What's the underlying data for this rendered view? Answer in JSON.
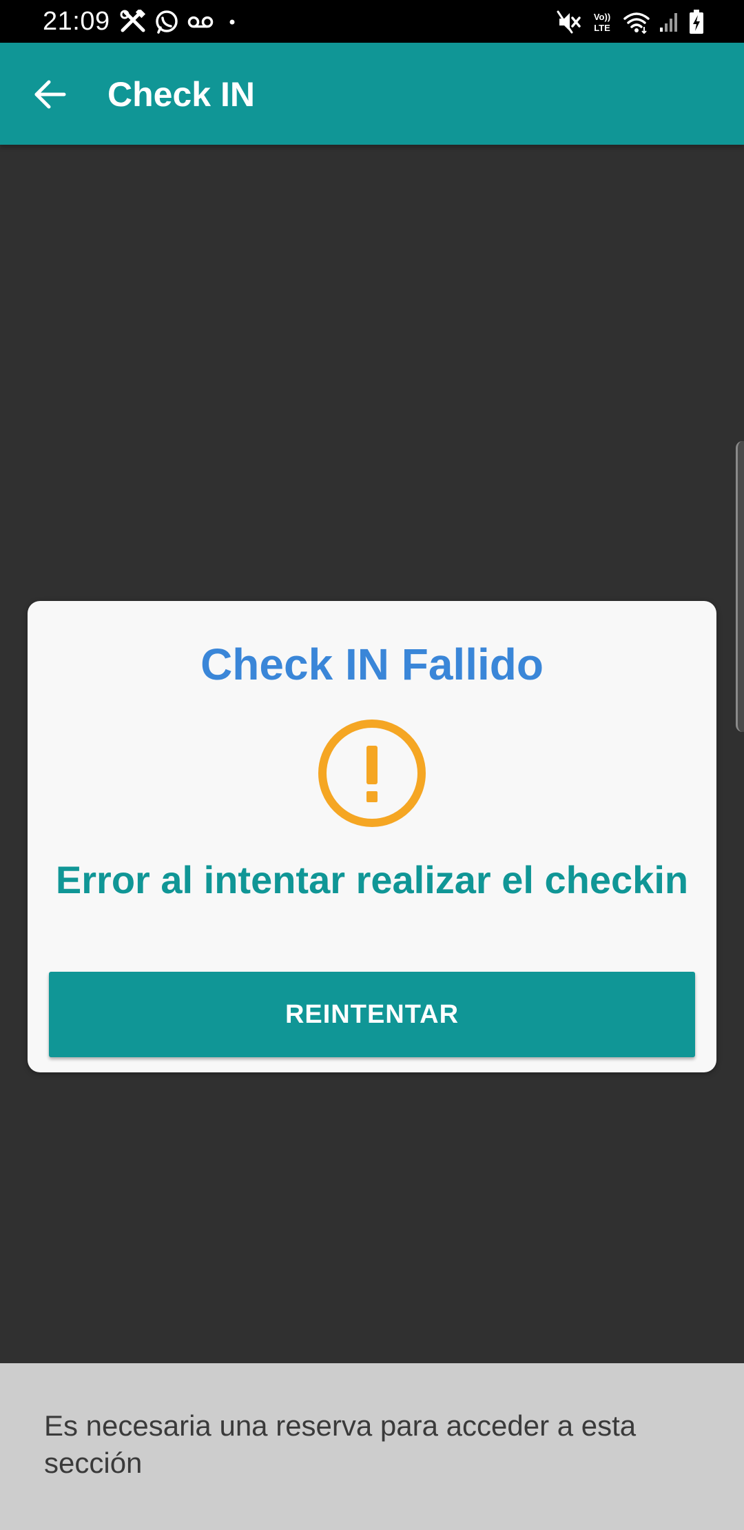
{
  "status_bar": {
    "time": "21:09",
    "left_icons": [
      "tools-icon",
      "whatsapp-icon",
      "voicemail-icon",
      "dot-icon"
    ],
    "right_icons": [
      "mute-icon",
      "volte-icon",
      "wifi-icon",
      "signal-icon",
      "battery-charging-icon"
    ],
    "volte_label_top": "Vo))",
    "volte_label_bottom": "LTE"
  },
  "app_bar": {
    "title": "Check IN",
    "back_icon": "arrow-back-icon",
    "background_color": "#109696"
  },
  "dialog": {
    "title": "Check IN Fallido",
    "icon": "warning-icon",
    "icon_color": "#F5A623",
    "message": "Error al intentar realizar el checkin",
    "retry_button_label": "REINTENTAR",
    "title_color": "#3A86D8",
    "accent_color": "#109696"
  },
  "bottom_banner": {
    "message": "Es necesaria una reserva para acceder a esta sección"
  }
}
